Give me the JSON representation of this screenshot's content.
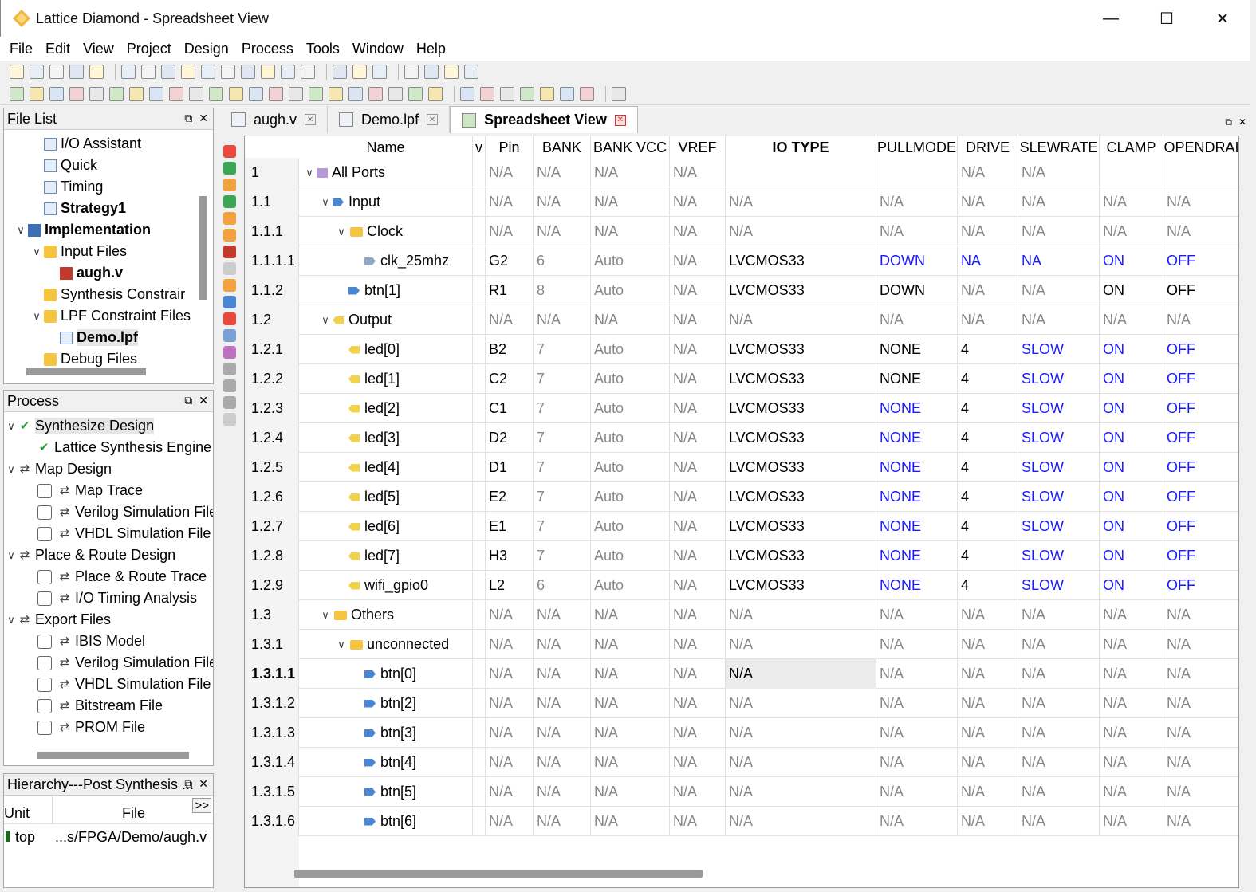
{
  "window": {
    "title": "Lattice Diamond - Spreadsheet View"
  },
  "menu": [
    "File",
    "Edit",
    "View",
    "Project",
    "Design",
    "Process",
    "Tools",
    "Window",
    "Help"
  ],
  "file_list": {
    "title": "File List",
    "items": [
      {
        "label": "I/O Assistant",
        "indent": 2,
        "bold": false
      },
      {
        "label": "Quick",
        "indent": 2,
        "bold": false
      },
      {
        "label": "Timing",
        "indent": 2,
        "bold": false
      },
      {
        "label": "Strategy1",
        "indent": 2,
        "bold": true
      },
      {
        "label": "Implementation",
        "indent": 1,
        "bold": true
      },
      {
        "label": "Input Files",
        "indent": 2,
        "bold": false
      },
      {
        "label": "augh.v",
        "indent": 3,
        "bold": true
      },
      {
        "label": "Synthesis Constrair",
        "indent": 2,
        "bold": false
      },
      {
        "label": "LPF Constraint Files",
        "indent": 2,
        "bold": false
      },
      {
        "label": "Demo.lpf",
        "indent": 3,
        "bold": true
      },
      {
        "label": "Debug Files",
        "indent": 2,
        "bold": false
      }
    ]
  },
  "process": {
    "title": "Process",
    "items": [
      {
        "label": "Synthesize Design",
        "type": "group"
      },
      {
        "label": "Lattice Synthesis Engine",
        "type": "sub"
      },
      {
        "label": "Map Design",
        "type": "group"
      },
      {
        "label": "Map Trace",
        "type": "check"
      },
      {
        "label": "Verilog Simulation File",
        "type": "check"
      },
      {
        "label": "VHDL Simulation File",
        "type": "check"
      },
      {
        "label": "Place & Route Design",
        "type": "group"
      },
      {
        "label": "Place & Route Trace",
        "type": "check"
      },
      {
        "label": "I/O Timing Analysis",
        "type": "check"
      },
      {
        "label": "Export Files",
        "type": "group"
      },
      {
        "label": "IBIS Model",
        "type": "check"
      },
      {
        "label": "Verilog Simulation File",
        "type": "check"
      },
      {
        "label": "VHDL Simulation File",
        "type": "check"
      },
      {
        "label": "Bitstream File",
        "type": "check"
      },
      {
        "label": "PROM File",
        "type": "check"
      }
    ]
  },
  "hierarchy": {
    "title": "Hierarchy---Post Synthesis ...",
    "col_unit": "Unit",
    "col_file": "File",
    "more": ">>",
    "row_unit": "top",
    "row_file": "...s/FPGA/Demo/augh.v"
  },
  "tabs": [
    {
      "label": "augh.v",
      "active": false
    },
    {
      "label": "Demo.lpf",
      "active": false
    },
    {
      "label": "Spreadsheet View",
      "active": true
    }
  ],
  "sheet": {
    "headers": [
      "Name",
      "v",
      "Pin",
      "BANK",
      "BANK VCC",
      "VREF",
      "IO TYPE",
      "PULLMODE",
      "DRIVE",
      "SLEWRATE",
      "CLAMP",
      "OPENDRAI"
    ],
    "rows": [
      {
        "num": "1",
        "name": "All Ports",
        "indent": 0,
        "chev": true,
        "icon": "root",
        "pin": "N/A",
        "bank": "N/A",
        "vcc": "N/A",
        "vref": "N/A",
        "io": "",
        "pull": "",
        "drive": "N/A",
        "slew": "N/A",
        "clamp": "",
        "od": "",
        "style": "gray"
      },
      {
        "num": "1.1",
        "name": "Input",
        "indent": 1,
        "chev": true,
        "icon": "blue",
        "pin": "N/A",
        "bank": "N/A",
        "vcc": "N/A",
        "vref": "N/A",
        "io": "N/A",
        "pull": "N/A",
        "drive": "N/A",
        "slew": "N/A",
        "clamp": "N/A",
        "od": "N/A",
        "style": "gray"
      },
      {
        "num": "1.1.1",
        "name": "Clock",
        "indent": 2,
        "chev": true,
        "icon": "folder",
        "pin": "N/A",
        "bank": "N/A",
        "vcc": "N/A",
        "vref": "N/A",
        "io": "N/A",
        "pull": "N/A",
        "drive": "N/A",
        "slew": "N/A",
        "clamp": "N/A",
        "od": "N/A",
        "style": "gray"
      },
      {
        "num": "1.1.1.1",
        "name": "clk_25mhz",
        "indent": 3,
        "chev": false,
        "icon": "clk",
        "pin": "G2",
        "bank": "6",
        "vcc": "Auto",
        "vref": "N/A",
        "io": "LVCMOS33",
        "pull": "DOWN",
        "drive": "NA",
        "slew": "NA",
        "clamp": "ON",
        "od": "OFF",
        "style": "clk"
      },
      {
        "num": "1.1.2",
        "name": "btn[1]",
        "indent": 2,
        "chev": false,
        "icon": "blue",
        "pin": "R1",
        "bank": "8",
        "vcc": "Auto",
        "vref": "N/A",
        "io": "LVCMOS33",
        "pull": "DOWN",
        "drive": "N/A",
        "slew": "N/A",
        "clamp": "ON",
        "od": "OFF",
        "style": "btn1"
      },
      {
        "num": "1.2",
        "name": "Output",
        "indent": 1,
        "chev": true,
        "icon": "yellow",
        "pin": "N/A",
        "bank": "N/A",
        "vcc": "N/A",
        "vref": "N/A",
        "io": "N/A",
        "pull": "N/A",
        "drive": "N/A",
        "slew": "N/A",
        "clamp": "N/A",
        "od": "N/A",
        "style": "gray"
      },
      {
        "num": "1.2.1",
        "name": "led[0]",
        "indent": 2,
        "chev": false,
        "icon": "yellow",
        "pin": "B2",
        "bank": "7",
        "vcc": "Auto",
        "vref": "N/A",
        "io": "LVCMOS33",
        "pull": "NONE",
        "drive": "4",
        "slew": "SLOW",
        "clamp": "ON",
        "od": "OFF",
        "style": "led_dark"
      },
      {
        "num": "1.2.2",
        "name": "led[1]",
        "indent": 2,
        "chev": false,
        "icon": "yellow",
        "pin": "C2",
        "bank": "7",
        "vcc": "Auto",
        "vref": "N/A",
        "io": "LVCMOS33",
        "pull": "NONE",
        "drive": "4",
        "slew": "SLOW",
        "clamp": "ON",
        "od": "OFF",
        "style": "led_dark"
      },
      {
        "num": "1.2.3",
        "name": "led[2]",
        "indent": 2,
        "chev": false,
        "icon": "yellow",
        "pin": "C1",
        "bank": "7",
        "vcc": "Auto",
        "vref": "N/A",
        "io": "LVCMOS33",
        "pull": "NONE",
        "drive": "4",
        "slew": "SLOW",
        "clamp": "ON",
        "od": "OFF",
        "style": "led"
      },
      {
        "num": "1.2.4",
        "name": "led[3]",
        "indent": 2,
        "chev": false,
        "icon": "yellow",
        "pin": "D2",
        "bank": "7",
        "vcc": "Auto",
        "vref": "N/A",
        "io": "LVCMOS33",
        "pull": "NONE",
        "drive": "4",
        "slew": "SLOW",
        "clamp": "ON",
        "od": "OFF",
        "style": "led"
      },
      {
        "num": "1.2.5",
        "name": "led[4]",
        "indent": 2,
        "chev": false,
        "icon": "yellow",
        "pin": "D1",
        "bank": "7",
        "vcc": "Auto",
        "vref": "N/A",
        "io": "LVCMOS33",
        "pull": "NONE",
        "drive": "4",
        "slew": "SLOW",
        "clamp": "ON",
        "od": "OFF",
        "style": "led"
      },
      {
        "num": "1.2.6",
        "name": "led[5]",
        "indent": 2,
        "chev": false,
        "icon": "yellow",
        "pin": "E2",
        "bank": "7",
        "vcc": "Auto",
        "vref": "N/A",
        "io": "LVCMOS33",
        "pull": "NONE",
        "drive": "4",
        "slew": "SLOW",
        "clamp": "ON",
        "od": "OFF",
        "style": "led"
      },
      {
        "num": "1.2.7",
        "name": "led[6]",
        "indent": 2,
        "chev": false,
        "icon": "yellow",
        "pin": "E1",
        "bank": "7",
        "vcc": "Auto",
        "vref": "N/A",
        "io": "LVCMOS33",
        "pull": "NONE",
        "drive": "4",
        "slew": "SLOW",
        "clamp": "ON",
        "od": "OFF",
        "style": "led"
      },
      {
        "num": "1.2.8",
        "name": "led[7]",
        "indent": 2,
        "chev": false,
        "icon": "yellow",
        "pin": "H3",
        "bank": "7",
        "vcc": "Auto",
        "vref": "N/A",
        "io": "LVCMOS33",
        "pull": "NONE",
        "drive": "4",
        "slew": "SLOW",
        "clamp": "ON",
        "od": "OFF",
        "style": "led"
      },
      {
        "num": "1.2.9",
        "name": "wifi_gpio0",
        "indent": 2,
        "chev": false,
        "icon": "yellow",
        "pin": "L2",
        "bank": "6",
        "vcc": "Auto",
        "vref": "N/A",
        "io": "LVCMOS33",
        "pull": "NONE",
        "drive": "4",
        "slew": "SLOW",
        "clamp": "ON",
        "od": "OFF",
        "style": "led"
      },
      {
        "num": "1.3",
        "name": "Others",
        "indent": 1,
        "chev": true,
        "icon": "folder",
        "pin": "N/A",
        "bank": "N/A",
        "vcc": "N/A",
        "vref": "N/A",
        "io": "N/A",
        "pull": "N/A",
        "drive": "N/A",
        "slew": "N/A",
        "clamp": "N/A",
        "od": "N/A",
        "style": "gray"
      },
      {
        "num": "1.3.1",
        "name": "unconnected",
        "indent": 2,
        "chev": true,
        "icon": "folder",
        "pin": "N/A",
        "bank": "N/A",
        "vcc": "N/A",
        "vref": "N/A",
        "io": "N/A",
        "pull": "N/A",
        "drive": "N/A",
        "slew": "N/A",
        "clamp": "N/A",
        "od": "N/A",
        "style": "gray"
      },
      {
        "num": "1.3.1.1",
        "name": "btn[0]",
        "indent": 3,
        "chev": false,
        "icon": "blue",
        "pin": "N/A",
        "bank": "N/A",
        "vcc": "N/A",
        "vref": "N/A",
        "io": "N/A",
        "pull": "N/A",
        "drive": "N/A",
        "slew": "N/A",
        "clamp": "N/A",
        "od": "N/A",
        "style": "selected"
      },
      {
        "num": "1.3.1.2",
        "name": "btn[2]",
        "indent": 3,
        "chev": false,
        "icon": "blue",
        "pin": "N/A",
        "bank": "N/A",
        "vcc": "N/A",
        "vref": "N/A",
        "io": "N/A",
        "pull": "N/A",
        "drive": "N/A",
        "slew": "N/A",
        "clamp": "N/A",
        "od": "N/A",
        "style": "gray"
      },
      {
        "num": "1.3.1.3",
        "name": "btn[3]",
        "indent": 3,
        "chev": false,
        "icon": "blue",
        "pin": "N/A",
        "bank": "N/A",
        "vcc": "N/A",
        "vref": "N/A",
        "io": "N/A",
        "pull": "N/A",
        "drive": "N/A",
        "slew": "N/A",
        "clamp": "N/A",
        "od": "N/A",
        "style": "gray"
      },
      {
        "num": "1.3.1.4",
        "name": "btn[4]",
        "indent": 3,
        "chev": false,
        "icon": "blue",
        "pin": "N/A",
        "bank": "N/A",
        "vcc": "N/A",
        "vref": "N/A",
        "io": "N/A",
        "pull": "N/A",
        "drive": "N/A",
        "slew": "N/A",
        "clamp": "N/A",
        "od": "N/A",
        "style": "gray"
      },
      {
        "num": "1.3.1.5",
        "name": "btn[5]",
        "indent": 3,
        "chev": false,
        "icon": "blue",
        "pin": "N/A",
        "bank": "N/A",
        "vcc": "N/A",
        "vref": "N/A",
        "io": "N/A",
        "pull": "N/A",
        "drive": "N/A",
        "slew": "N/A",
        "clamp": "N/A",
        "od": "N/A",
        "style": "gray"
      },
      {
        "num": "1.3.1.6",
        "name": "btn[6]",
        "indent": 3,
        "chev": false,
        "icon": "blue",
        "pin": "N/A",
        "bank": "N/A",
        "vcc": "N/A",
        "vref": "N/A",
        "io": "N/A",
        "pull": "N/A",
        "drive": "N/A",
        "slew": "N/A",
        "clamp": "N/A",
        "od": "N/A",
        "style": "gray"
      }
    ]
  },
  "colors": {
    "link_blue": "#1a1aff",
    "na_gray": "#888888",
    "close_red": "#d33333"
  }
}
